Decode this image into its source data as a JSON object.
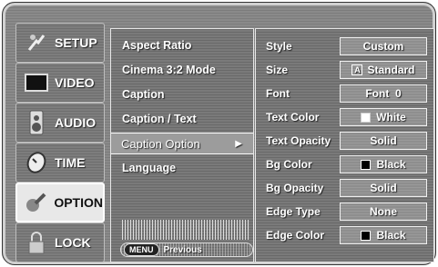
{
  "tabs": [
    {
      "label": "SETUP",
      "icon": "setup-icon",
      "selected": false
    },
    {
      "label": "VIDEO",
      "icon": "video-icon",
      "selected": false
    },
    {
      "label": "AUDIO",
      "icon": "audio-icon",
      "selected": false
    },
    {
      "label": "TIME",
      "icon": "time-icon",
      "selected": false
    },
    {
      "label": "OPTION",
      "icon": "option-icon",
      "selected": true
    },
    {
      "label": "LOCK",
      "icon": "lock-icon",
      "selected": false
    }
  ],
  "submenu": {
    "items": [
      {
        "label": "Aspect Ratio"
      },
      {
        "label": "Cinema 3:2 Mode"
      },
      {
        "label": "Caption"
      },
      {
        "label": "Caption / Text"
      },
      {
        "label": "Caption Option",
        "selected": true
      },
      {
        "label": "Language"
      }
    ],
    "footer": {
      "key": "MENU",
      "label": "Previous"
    }
  },
  "settings": [
    {
      "label": "Style",
      "value": "Custom"
    },
    {
      "label": "Size",
      "value": "Standard",
      "icon": "A",
      "icon_name": "text-size-icon"
    },
    {
      "label": "Font",
      "value": "Font  0"
    },
    {
      "label": "Text Color",
      "value": "White",
      "swatch": "#ffffff"
    },
    {
      "label": "Text Opacity",
      "value": "Solid"
    },
    {
      "label": "Bg Color",
      "value": "Black",
      "swatch": "#000000"
    },
    {
      "label": "Bg Opacity",
      "value": "Solid"
    },
    {
      "label": "Edge Type",
      "value": "None"
    },
    {
      "label": "Edge Color",
      "value": "Black",
      "swatch": "#000000"
    }
  ],
  "arrow_glyph": "▶"
}
